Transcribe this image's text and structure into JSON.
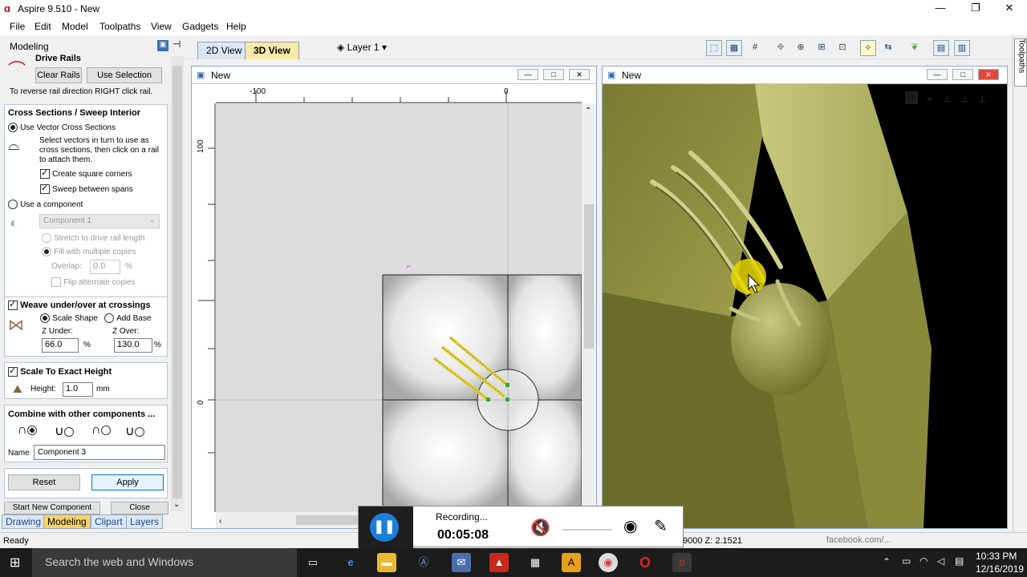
{
  "window": {
    "title": "Aspire 9.510 - New"
  },
  "menu": [
    "File",
    "Edit",
    "Model",
    "Toolpaths",
    "View",
    "Gadgets",
    "Help"
  ],
  "view_tabs": {
    "tab_2d": "2D View",
    "tab_3d": "3D View",
    "layer": "Layer 1"
  },
  "panel": {
    "title": "Modeling",
    "drive_rails": {
      "heading": "Drive Rails",
      "clear_rails": "Clear Rails",
      "use_selection": "Use Selection",
      "hint": "To reverse rail direction RIGHT click rail."
    },
    "cross_sections": {
      "heading": "Cross Sections / Sweep Interior",
      "use_vector": "Use Vector Cross Sections",
      "description": "Select vectors in turn to use as cross sections, then click on a rail to attach them.",
      "square_corners": "Create square corners",
      "sweep_spans": "Sweep between spans",
      "use_component": "Use a component",
      "component_select": "Component 1",
      "stretch": "Stretch to drive rail length",
      "fill_multiple": "Fill with multiple copies",
      "overlap_label": "Overlap:",
      "overlap_value": "0.0",
      "overlap_unit": "%",
      "flip": "Flip alternate copies"
    },
    "weave": {
      "heading": "Weave under/over at crossings",
      "scale_shape": "Scale Shape",
      "add_base": "Add Base",
      "z_under_label": "Z Under:",
      "z_under_value": "66.0",
      "z_over_label": "Z Over:",
      "z_over_value": "130.0",
      "unit": "%"
    },
    "scale_height": {
      "heading": "Scale To Exact Height",
      "height_label": "Height:",
      "height_value": "1.0",
      "unit": "mm"
    },
    "combine": {
      "heading": "Combine with other components ...",
      "name_label": "Name",
      "name_value": "Component 3"
    },
    "reset": "Reset",
    "apply": "Apply",
    "start_new": "Start New Component",
    "close": "Close",
    "bottom_tabs": [
      "Drawing",
      "Modeling",
      "Clipart",
      "Layers"
    ]
  },
  "view2d": {
    "title": "New",
    "ruler_top": [
      "-100",
      "0"
    ],
    "ruler_left": [
      "100",
      "0"
    ]
  },
  "view3d": {
    "title": "New"
  },
  "side_tab": "Toolpaths",
  "status": {
    "left": "Ready",
    "coords": "9000 Z: 2.1521"
  },
  "recorder": {
    "label": "Recording...",
    "time": "00:05:08"
  },
  "taskbar": {
    "search": "Search the web and Windows",
    "time": "10:33 PM",
    "date": "12/16/2019",
    "watermark": "facebook.com/..."
  }
}
